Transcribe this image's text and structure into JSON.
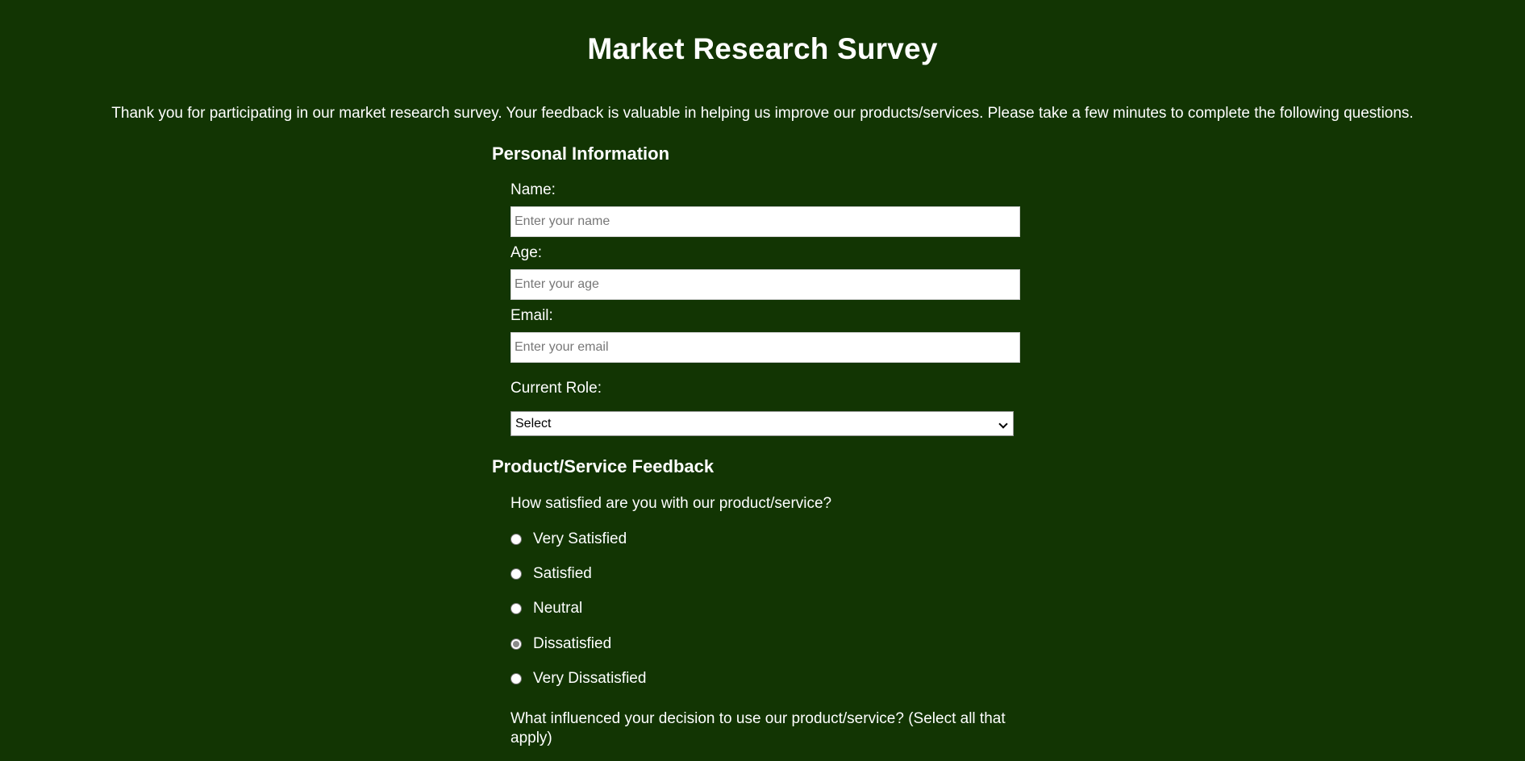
{
  "header": {
    "title": "Market Research Survey",
    "intro": "Thank you for participating in our market research survey. Your feedback is valuable in helping us improve our products/services. Please take a few minutes to complete the following questions."
  },
  "personal": {
    "heading": "Personal Information",
    "name_label": "Name:",
    "name_placeholder": "Enter your name",
    "age_label": "Age:",
    "age_placeholder": "Enter your age",
    "email_label": "Email:",
    "email_placeholder": "Enter your email",
    "role_label": "Current Role:",
    "role_selected": "Select"
  },
  "feedback": {
    "heading": "Product/Service Feedback",
    "satisfaction_question": "How satisfied are you with our product/service?",
    "options": [
      {
        "label": "Very Satisfied",
        "checked": false
      },
      {
        "label": "Satisfied",
        "checked": false
      },
      {
        "label": "Neutral",
        "checked": false
      },
      {
        "label": "Dissatisfied",
        "checked": true
      },
      {
        "label": "Very Dissatisfied",
        "checked": false
      }
    ],
    "influence_question": "What influenced your decision to use our product/service? (Select all that apply)"
  },
  "colors": {
    "background": "#123503",
    "text": "#ffffff"
  }
}
